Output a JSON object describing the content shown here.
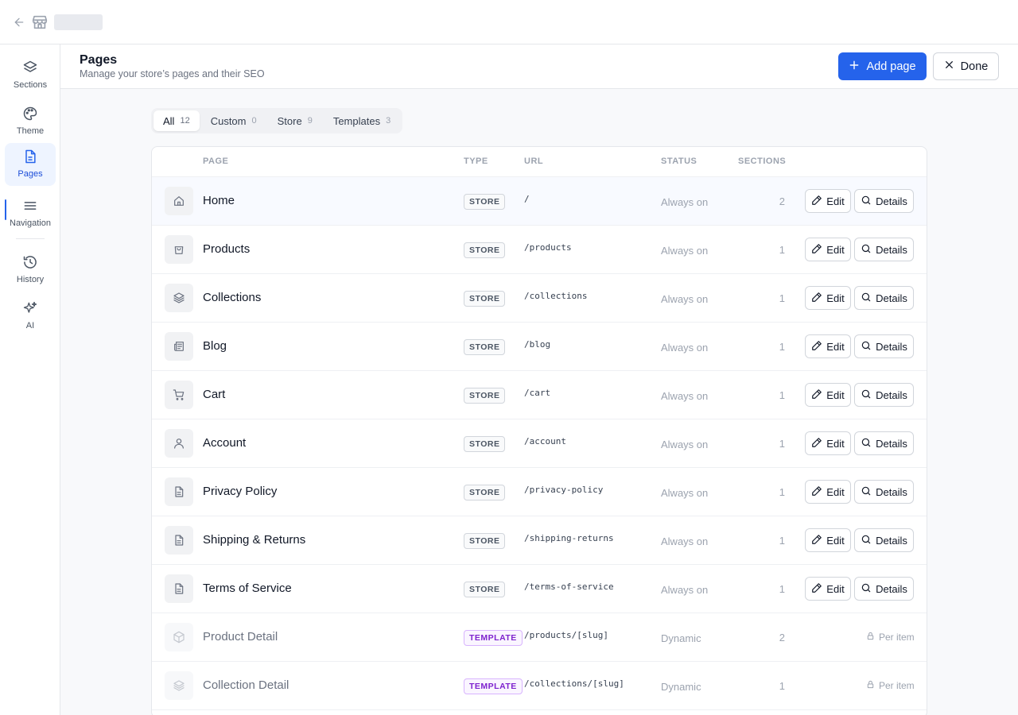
{
  "sidebar": {
    "items": [
      {
        "label": "Sections",
        "icon": "layers-icon"
      },
      {
        "label": "Theme",
        "icon": "palette-icon"
      },
      {
        "label": "Pages",
        "icon": "document-icon",
        "active": true
      },
      {
        "label": "Navigation",
        "icon": "menu-icon"
      },
      {
        "label": "History",
        "icon": "history-icon"
      },
      {
        "label": "AI",
        "icon": "sparkle-icon"
      }
    ]
  },
  "header": {
    "title": "Pages",
    "subtitle": "Manage your store’s pages and their SEO",
    "add_label": "Add page",
    "done_label": "Done"
  },
  "tabs": [
    {
      "label": "All",
      "count": "12"
    },
    {
      "label": "Custom",
      "count": "0"
    },
    {
      "label": "Store",
      "count": "9"
    },
    {
      "label": "Templates",
      "count": "3"
    }
  ],
  "table": {
    "columns": {
      "page": "PAGE",
      "type": "TYPE",
      "url": "URL",
      "status": "STATUS",
      "sections": "SECTIONS"
    },
    "edit_label": "Edit",
    "details_label": "Details",
    "per_item_label": "Per item",
    "rows": [
      {
        "name": "Home",
        "type": "STORE",
        "url": "/",
        "status": "Always on",
        "sections": "2",
        "icon": "home-icon"
      },
      {
        "name": "Products",
        "type": "STORE",
        "url": "/products",
        "status": "Always on",
        "sections": "1",
        "icon": "shopping-bag-icon"
      },
      {
        "name": "Collections",
        "type": "STORE",
        "url": "/collections",
        "status": "Always on",
        "sections": "1",
        "icon": "layers-icon"
      },
      {
        "name": "Blog",
        "type": "STORE",
        "url": "/blog",
        "status": "Always on",
        "sections": "1",
        "icon": "newspaper-icon"
      },
      {
        "name": "Cart",
        "type": "STORE",
        "url": "/cart",
        "status": "Always on",
        "sections": "1",
        "icon": "cart-icon"
      },
      {
        "name": "Account",
        "type": "STORE",
        "url": "/account",
        "status": "Always on",
        "sections": "1",
        "icon": "user-icon"
      },
      {
        "name": "Privacy Policy",
        "type": "STORE",
        "url": "/privacy-policy",
        "status": "Always on",
        "sections": "1",
        "icon": "file-text-icon"
      },
      {
        "name": "Shipping & Returns",
        "type": "STORE",
        "url": "/shipping-returns",
        "status": "Always on",
        "sections": "1",
        "icon": "file-text-icon"
      },
      {
        "name": "Terms of Service",
        "type": "STORE",
        "url": "/terms-of-service",
        "status": "Always on",
        "sections": "1",
        "icon": "file-text-icon"
      },
      {
        "name": "Product Detail",
        "type": "TEMPLATE",
        "url": "/products/[slug]",
        "status": "Dynamic",
        "sections": "2",
        "icon": "box-icon"
      },
      {
        "name": "Collection Detail",
        "type": "TEMPLATE",
        "url": "/collections/[slug]",
        "status": "Dynamic",
        "sections": "1",
        "icon": "layers-icon"
      }
    ]
  },
  "colors": {
    "accent": "#2563eb",
    "template_badge": "#7e22ce",
    "border": "#e5e7eb"
  }
}
